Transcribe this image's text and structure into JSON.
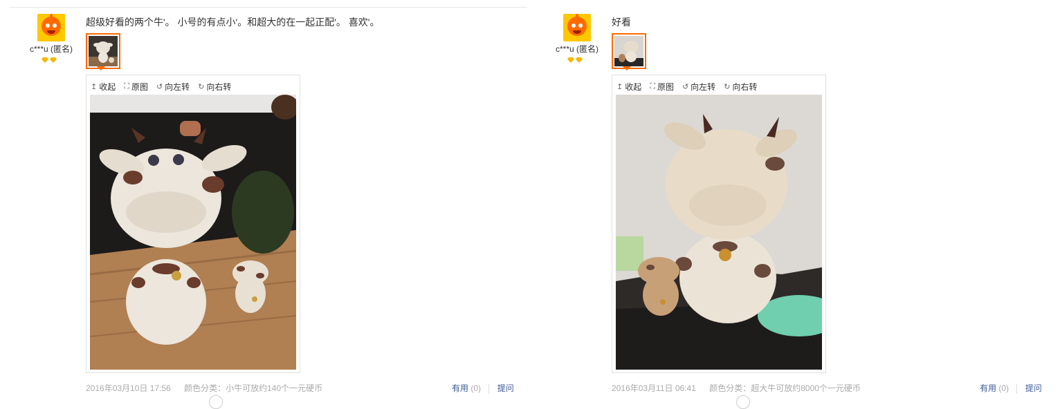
{
  "reviews": [
    {
      "user": "c***u (匿名)",
      "comment": "超级好看的两个牛'。 小号的有点小'。和超大的在一起正配'。 喜欢'。",
      "toolbar": {
        "collapse": "收起",
        "original": "原图",
        "rotate_left": "向左转",
        "rotate_right": "向右转"
      },
      "date": "2016年03月10日 17:56",
      "sku": "颜色分类：小牛可放约140个一元硬币",
      "useful_label": "有用",
      "useful_count": "(0)",
      "ask_label": "提问"
    },
    {
      "user": "c***u (匿名)",
      "comment": "好看",
      "toolbar": {
        "collapse": "收起",
        "original": "原图",
        "rotate_left": "向左转",
        "rotate_right": "向右转"
      },
      "date": "2016年03月11日 06:41",
      "sku": "颜色分类：超大牛可放约8000个一元硬币",
      "useful_label": "有用",
      "useful_count": "(0)",
      "ask_label": "提问"
    }
  ],
  "colors": {
    "accent": "#ff6a00",
    "link": "#3c5a96",
    "muted": "#aaaaaa",
    "badge": "#f5b800"
  },
  "icons": {
    "collapse": "arrow-up-icon",
    "original": "expand-icon",
    "rotate_left": "rotate-left-icon",
    "rotate_right": "rotate-right-icon"
  }
}
